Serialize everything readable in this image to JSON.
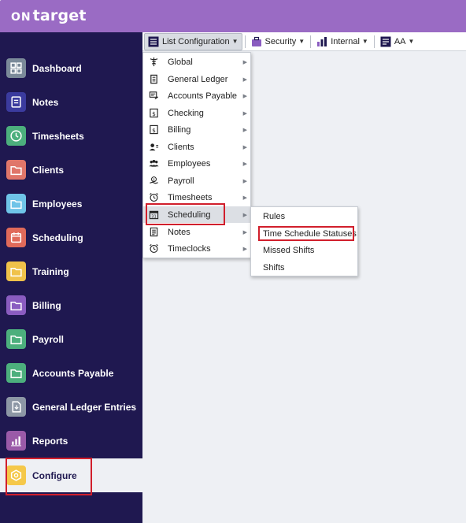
{
  "app": {
    "logo_on": "ON",
    "logo_target": "target"
  },
  "colors": {
    "header": "#9a6bc4",
    "sidebar": "#1f1850",
    "highlight": "#d11f2c"
  },
  "sidebar": {
    "items": [
      {
        "label": "Dashboard",
        "icon": "grid-icon",
        "color": "#7b8a99"
      },
      {
        "label": "Notes",
        "icon": "notes-icon",
        "color": "#3b3b9e"
      },
      {
        "label": "Timesheets",
        "icon": "clock-icon",
        "color": "#4caf7d"
      },
      {
        "label": "Clients",
        "icon": "folder-icon",
        "color": "#e0766a"
      },
      {
        "label": "Employees",
        "icon": "folder-icon",
        "color": "#6fc4e8"
      },
      {
        "label": "Scheduling",
        "icon": "calendar-icon",
        "color": "#e06a5a"
      },
      {
        "label": "Training",
        "icon": "folder-icon",
        "color": "#f0c24a"
      },
      {
        "label": "Billing",
        "icon": "folder-icon",
        "color": "#8a5cc0"
      },
      {
        "label": "Payroll",
        "icon": "folder-icon",
        "color": "#4caf7d"
      },
      {
        "label": "Accounts Payable",
        "icon": "folder-icon",
        "color": "#4caf7d"
      },
      {
        "label": "General Ledger Entries",
        "icon": "document-icon",
        "color": "#8d97a5"
      },
      {
        "label": "Reports",
        "icon": "bar-chart-icon",
        "color": "#9a5aa8"
      },
      {
        "label": "Configure",
        "icon": "hexagon-icon",
        "color": "#f5c84a",
        "active": true
      }
    ]
  },
  "toolbar": {
    "list_configuration": "List Configuration",
    "security": "Security",
    "internal": "Internal",
    "aa": "AA"
  },
  "list_menu": {
    "items": [
      {
        "label": "Global",
        "icon": "caduceus-icon"
      },
      {
        "label": "General Ledger",
        "icon": "ledger-icon"
      },
      {
        "label": "Accounts Payable",
        "icon": "invoice-icon"
      },
      {
        "label": "Checking",
        "icon": "dollar-icon"
      },
      {
        "label": "Billing",
        "icon": "dollar-icon"
      },
      {
        "label": "Clients",
        "icon": "person-list-icon"
      },
      {
        "label": "Employees",
        "icon": "people-icon"
      },
      {
        "label": "Payroll",
        "icon": "hand-money-icon"
      },
      {
        "label": "Timesheets",
        "icon": "alarm-clock-icon"
      },
      {
        "label": "Scheduling",
        "icon": "calendar-icon",
        "hover": true
      },
      {
        "label": "Notes",
        "icon": "notepad-icon"
      },
      {
        "label": "Timeclocks",
        "icon": "alarm-clock-icon"
      }
    ]
  },
  "scheduling_submenu": {
    "items": [
      {
        "label": "Rules"
      },
      {
        "label": "Time Schedule Statuses"
      },
      {
        "label": "Missed Shifts"
      },
      {
        "label": "Shifts"
      }
    ]
  }
}
